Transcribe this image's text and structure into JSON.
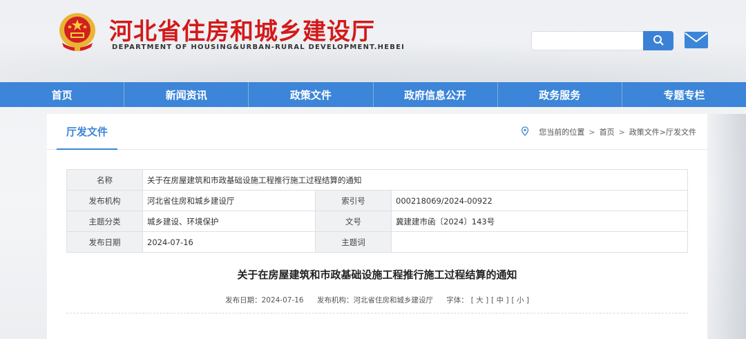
{
  "header": {
    "title": "河北省住房和城乡建设厅",
    "subtitle": "DEPARTMENT OF HOUSING&URBAN-RURAL DEVELOPMENT.HEBEI",
    "search": {
      "value": "",
      "placeholder": ""
    }
  },
  "icons": {
    "emblem": "national-emblem-icon",
    "search": "search-icon",
    "mail": "mail-icon",
    "location": "location-pin-icon"
  },
  "colors": {
    "brand_red": "#d21a1a",
    "nav_blue": "#3c85d8",
    "label_bg": "#f0f1f3"
  },
  "nav": {
    "items": [
      "首页",
      "新闻资讯",
      "政策文件",
      "政府信息公开",
      "政务服务",
      "专题专栏"
    ]
  },
  "section": {
    "title": "厅发文件",
    "breadcrumb": {
      "prefix": "您当前的位置",
      "items": [
        "首页",
        "政策文件>厅发文件"
      ]
    }
  },
  "meta": {
    "name_label": "名称",
    "name_value": "关于在房屋建筑和市政基础设施工程推行施工过程结算的通知",
    "publisher_label": "发布机构",
    "publisher_value": "河北省住房和城乡建设厅",
    "index_label": "索引号",
    "index_value": "000218069/2024-00922",
    "category_label": "主题分类",
    "category_value": "城乡建设、环境保护",
    "docno_label": "文号",
    "docno_value": "冀建建市函〔2024〕143号",
    "date_label": "发布日期",
    "date_value": "2024-07-16",
    "keywords_label": "主题词",
    "keywords_value": ""
  },
  "article": {
    "title": "关于在房屋建筑和市政基础设施工程推行施工过程结算的通知",
    "date_text": "发布日期：2024-07-16",
    "publisher_text": "发布机构：河北省住房和城乡建设厅",
    "font_label": "字体：",
    "font_sizes": [
      "[ 大 ]",
      "[ 中 ]",
      "[ 小 ]"
    ]
  }
}
